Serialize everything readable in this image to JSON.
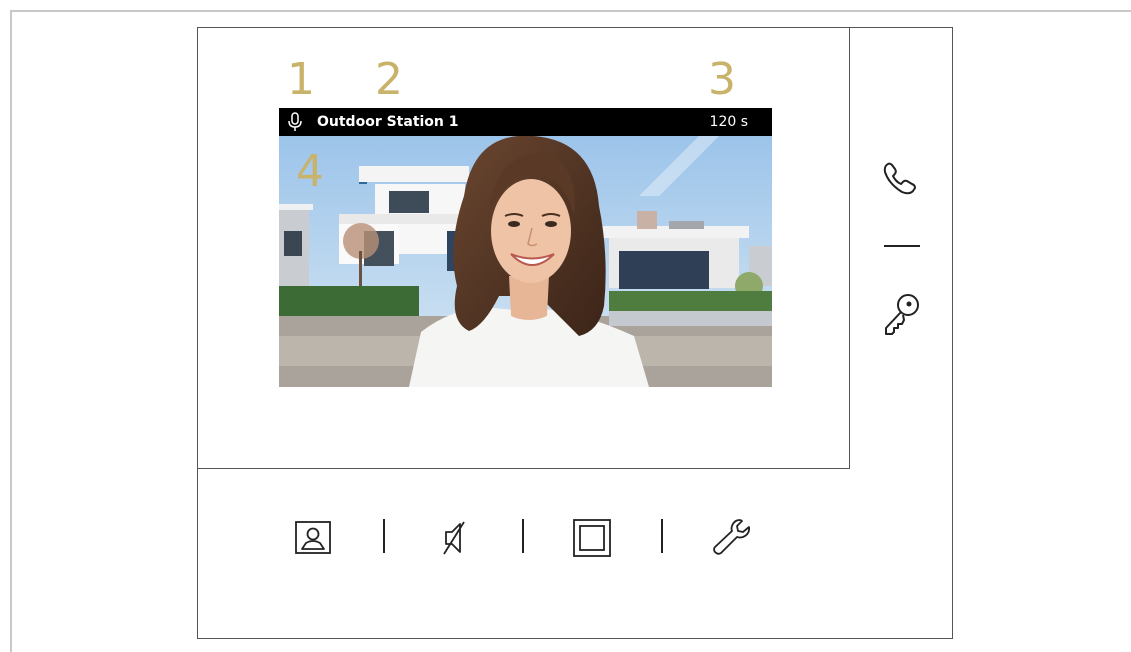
{
  "callouts": [
    "1",
    "2",
    "3",
    "4"
  ],
  "status_bar": {
    "station_name": "Outdoor Station 1",
    "timer": "120 s",
    "mic_icon": "microphone-icon"
  },
  "side_buttons": [
    {
      "icon": "phone-icon"
    },
    {
      "icon": "key-icon"
    }
  ],
  "bottom_buttons": [
    {
      "icon": "contact-photo-icon"
    },
    {
      "icon": "mute-speaker-icon"
    },
    {
      "icon": "fullscreen-square-icon"
    },
    {
      "icon": "wrench-settings-icon"
    }
  ],
  "colors": {
    "callout": "#c9b26a",
    "status_bar": "#000000",
    "frame": "#555555"
  }
}
